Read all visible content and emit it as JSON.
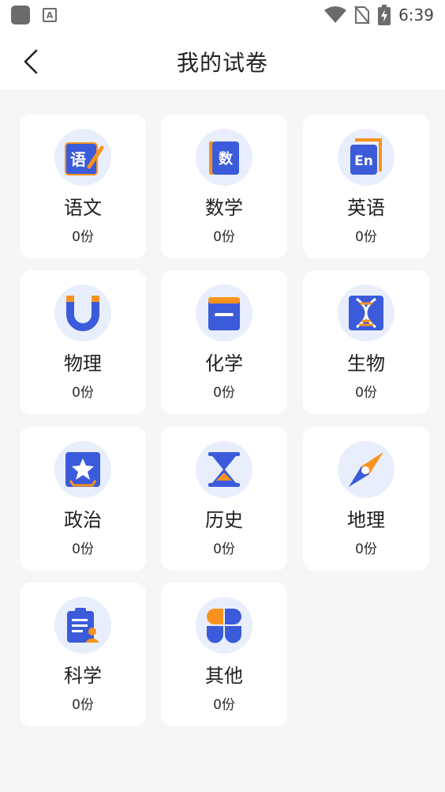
{
  "status_bar": {
    "time": "6:39",
    "notif_letter": "A"
  },
  "header": {
    "title": "我的试卷"
  },
  "colors": {
    "accent": "#3b5bdb",
    "orange": "#f7931e",
    "icon_bg": "#e9eefc"
  },
  "subjects": [
    {
      "name": "语文",
      "count": "0份",
      "icon": "chinese-icon",
      "glyph": "语"
    },
    {
      "name": "数学",
      "count": "0份",
      "icon": "math-icon",
      "glyph": "数"
    },
    {
      "name": "英语",
      "count": "0份",
      "icon": "english-icon",
      "glyph": "En"
    },
    {
      "name": "物理",
      "count": "0份",
      "icon": "magnet-icon"
    },
    {
      "name": "化学",
      "count": "0份",
      "icon": "chemistry-book-icon"
    },
    {
      "name": "生物",
      "count": "0份",
      "icon": "dna-icon"
    },
    {
      "name": "政治",
      "count": "0份",
      "icon": "star-badge-icon"
    },
    {
      "name": "历史",
      "count": "0份",
      "icon": "hourglass-icon"
    },
    {
      "name": "地理",
      "count": "0份",
      "icon": "compass-icon"
    },
    {
      "name": "科学",
      "count": "0份",
      "icon": "clipboard-user-icon"
    },
    {
      "name": "其他",
      "count": "0份",
      "icon": "clover-icon"
    }
  ]
}
